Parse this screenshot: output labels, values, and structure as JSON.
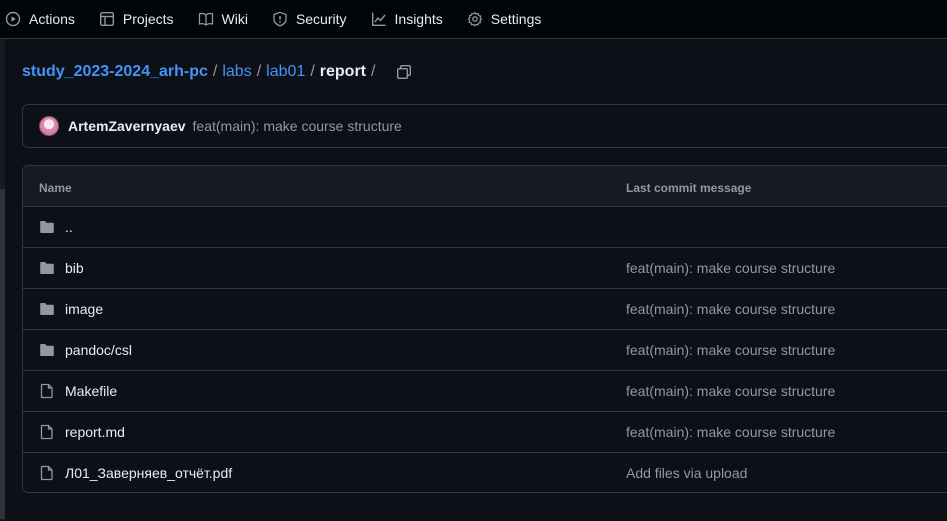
{
  "nav": {
    "items": [
      {
        "label": "Actions",
        "icon": "play-circle-icon"
      },
      {
        "label": "Projects",
        "icon": "table-icon"
      },
      {
        "label": "Wiki",
        "icon": "book-icon"
      },
      {
        "label": "Security",
        "icon": "shield-icon"
      },
      {
        "label": "Insights",
        "icon": "graph-icon"
      },
      {
        "label": "Settings",
        "icon": "gear-icon"
      }
    ]
  },
  "breadcrumb": {
    "repo": "study_2023-2024_arh-pc",
    "sep": "/",
    "parts": [
      "labs",
      "lab01"
    ],
    "current": "report"
  },
  "commit": {
    "author": "ArtemZavernyaev",
    "message": "feat(main): make course structure"
  },
  "table": {
    "headers": {
      "name": "Name",
      "message": "Last commit message"
    },
    "rows": [
      {
        "type": "folder",
        "name": "..",
        "message": ""
      },
      {
        "type": "folder",
        "name": "bib",
        "message": "feat(main): make course structure"
      },
      {
        "type": "folder",
        "name": "image",
        "message": "feat(main): make course structure"
      },
      {
        "type": "folder",
        "name": "pandoc/csl",
        "message": "feat(main): make course structure"
      },
      {
        "type": "file",
        "name": "Makefile",
        "message": "feat(main): make course structure"
      },
      {
        "type": "file",
        "name": "report.md",
        "message": "feat(main): make course structure"
      },
      {
        "type": "file",
        "name": "Л01_Заверняев_отчёт.pdf",
        "message": "Add files via upload"
      }
    ]
  },
  "colors": {
    "background": "#0d1117",
    "nav_background": "#010409",
    "link": "#4493f8",
    "muted": "#9198a1",
    "border": "#30363d",
    "folder_icon": "#9198a1"
  }
}
